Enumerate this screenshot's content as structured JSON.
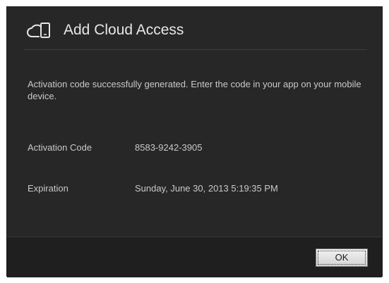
{
  "dialog": {
    "title": "Add Cloud Access",
    "icon": "cloud-device-icon",
    "message": "Activation code successfully generated. Enter the code in your app on your mobile device.",
    "fields": [
      {
        "label": "Activation Code",
        "value": "8583-9242-3905"
      },
      {
        "label": "Expiration",
        "value": "Sunday, June 30, 2013 5:19:35 PM"
      }
    ],
    "ok_label": "OK"
  },
  "colors": {
    "dialog_bg": "#272727",
    "footer_bg": "#1f1f1f",
    "title_text": "#e6e6e6",
    "body_text": "#c9c9c9"
  }
}
